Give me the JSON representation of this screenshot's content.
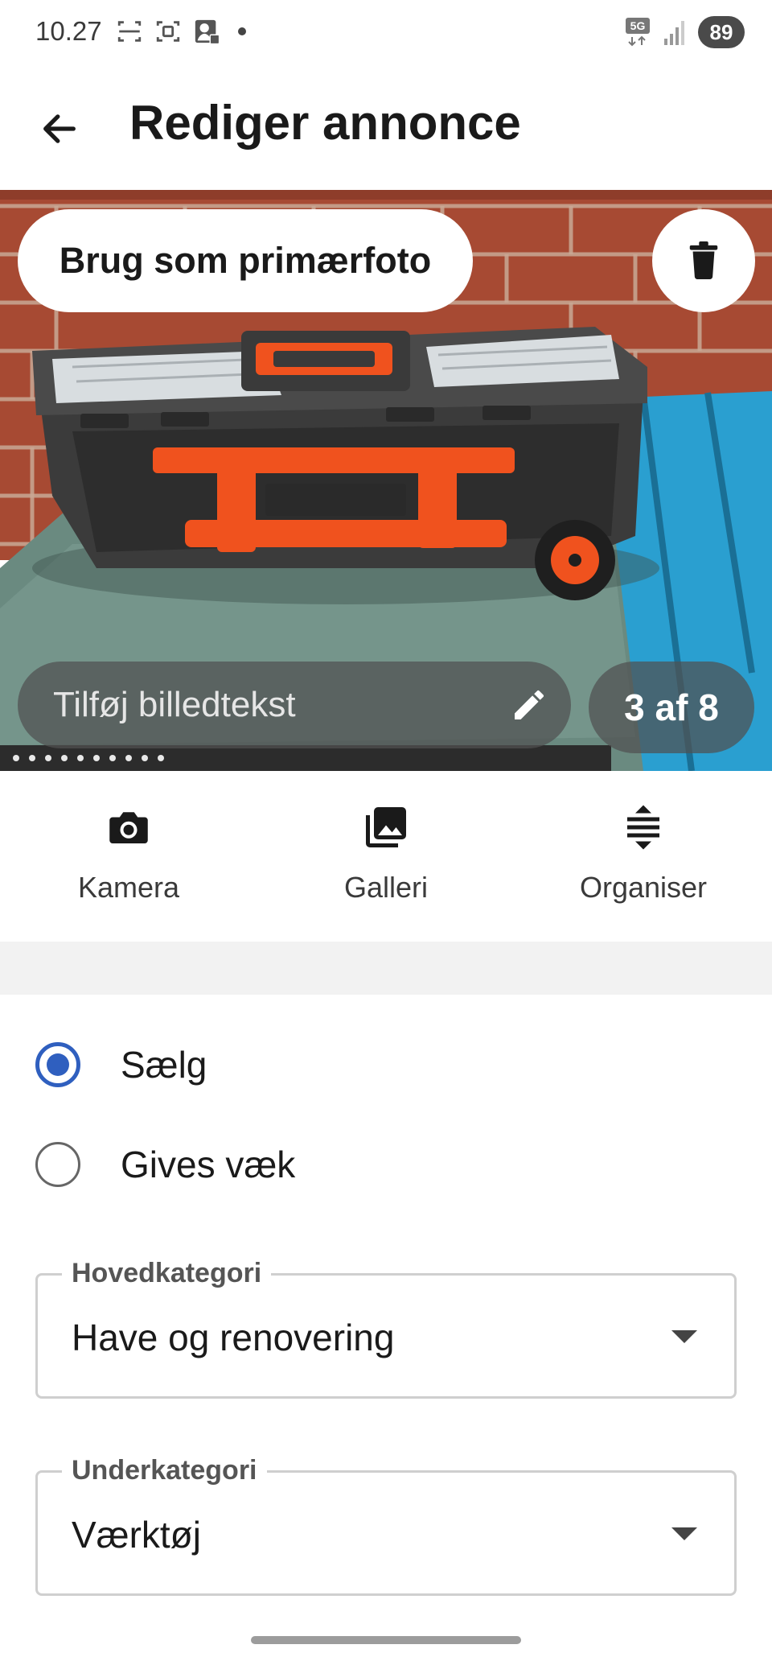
{
  "status_bar": {
    "time": "10.27",
    "network": "5G",
    "battery": "89",
    "icons": [
      "screen-record-icon",
      "screenshot-icon",
      "facebook-profile-icon",
      "notification-dot-icon",
      "network-5g-icon",
      "signal-icon",
      "battery-icon"
    ]
  },
  "header": {
    "title": "Rediger annonce",
    "back_icon": "arrow-left-icon"
  },
  "photo": {
    "primary_button": "Brug som primærfoto",
    "delete_icon": "trash-icon",
    "caption_placeholder": "Tilføj billedtekst",
    "caption_icon": "pencil-icon",
    "counter": "3 af 8"
  },
  "actions": [
    {
      "label": "Kamera",
      "icon": "camera-icon"
    },
    {
      "label": "Galleri",
      "icon": "gallery-icon"
    },
    {
      "label": "Organiser",
      "icon": "reorder-icon"
    }
  ],
  "listing_type": {
    "options": [
      {
        "label": "Sælg",
        "selected": true
      },
      {
        "label": "Gives væk",
        "selected": false
      }
    ]
  },
  "category": {
    "main_label": "Hovedkategori",
    "main_value": "Have og renovering",
    "sub_label": "Underkategori",
    "sub_value": "Værktøj"
  },
  "colors": {
    "accent": "#2f5fbf",
    "toolbox_orange": "#f0521e",
    "table_blue": "#2a9fd0",
    "brick": "#b4553a"
  }
}
